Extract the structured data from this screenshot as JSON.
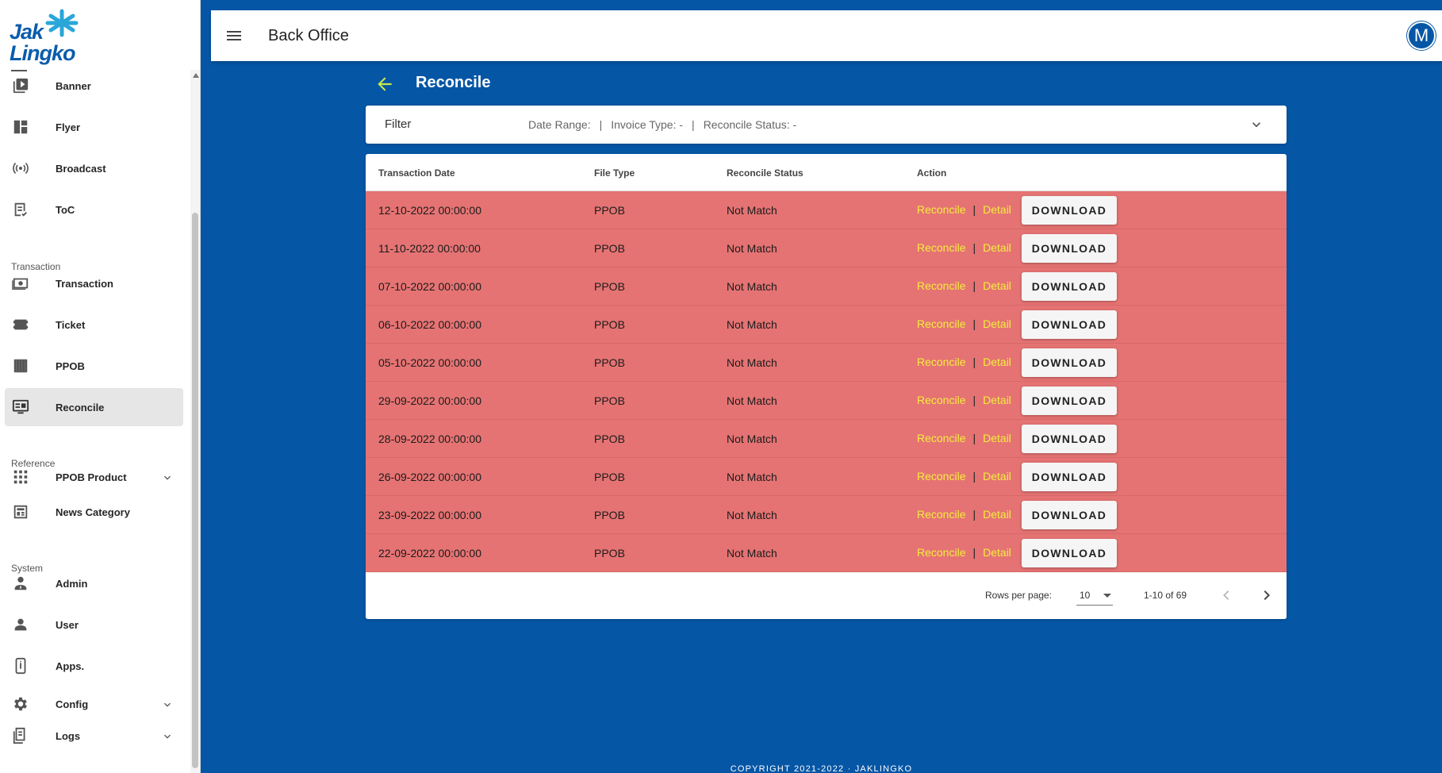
{
  "brand": {
    "line1": "Jak",
    "line2": "Lingko"
  },
  "appbar": {
    "title": "Back Office",
    "avatar_initial": "M"
  },
  "sidebar": {
    "items_top": [
      {
        "label": "Banner",
        "icon": "banner-icon"
      },
      {
        "label": "Flyer",
        "icon": "flyer-icon"
      },
      {
        "label": "Broadcast",
        "icon": "broadcast-icon"
      },
      {
        "label": "ToC",
        "icon": "toc-icon"
      }
    ],
    "section_transaction": "Transaction",
    "items_transaction": [
      {
        "label": "Transaction",
        "icon": "money-icon"
      },
      {
        "label": "Ticket",
        "icon": "ticket-icon"
      },
      {
        "label": "PPOB",
        "icon": "ppob-icon"
      },
      {
        "label": "Reconcile",
        "icon": "reconcile-icon",
        "active": true
      }
    ],
    "section_reference": "Reference",
    "items_reference": [
      {
        "label": "PPOB Product",
        "icon": "grid-icon",
        "expandable": true
      },
      {
        "label": "News Category",
        "icon": "news-icon"
      }
    ],
    "section_system": "System",
    "items_system": [
      {
        "label": "Admin",
        "icon": "admin-icon"
      },
      {
        "label": "User",
        "icon": "user-icon"
      },
      {
        "label": "Apps.",
        "icon": "apps-icon"
      },
      {
        "label": "Config",
        "icon": "gear-icon",
        "expandable": true
      },
      {
        "label": "Logs",
        "icon": "logs-icon",
        "expandable": true
      }
    ]
  },
  "page": {
    "title": "Reconcile"
  },
  "filter": {
    "title": "Filter",
    "date_range": "Date Range:",
    "invoice_type": "Invoice Type: -",
    "reconcile_status": "Reconcile Status: -",
    "separator": "|"
  },
  "table": {
    "headers": [
      "Transaction Date",
      "File Type",
      "Reconcile Status",
      "Action"
    ],
    "row_color": "#e57373",
    "action_reconcile": "Reconcile",
    "action_detail": "Detail",
    "action_sep": "|",
    "download_label": "DOWNLOAD",
    "rows": [
      {
        "date": "12-10-2022 00:00:00",
        "type": "PPOB",
        "status": "Not Match"
      },
      {
        "date": "11-10-2022 00:00:00",
        "type": "PPOB",
        "status": "Not Match"
      },
      {
        "date": "07-10-2022 00:00:00",
        "type": "PPOB",
        "status": "Not Match"
      },
      {
        "date": "06-10-2022 00:00:00",
        "type": "PPOB",
        "status": "Not Match"
      },
      {
        "date": "05-10-2022 00:00:00",
        "type": "PPOB",
        "status": "Not Match"
      },
      {
        "date": "29-09-2022 00:00:00",
        "type": "PPOB",
        "status": "Not Match"
      },
      {
        "date": "28-09-2022 00:00:00",
        "type": "PPOB",
        "status": "Not Match"
      },
      {
        "date": "26-09-2022 00:00:00",
        "type": "PPOB",
        "status": "Not Match"
      },
      {
        "date": "23-09-2022 00:00:00",
        "type": "PPOB",
        "status": "Not Match"
      },
      {
        "date": "22-09-2022 00:00:00",
        "type": "PPOB",
        "status": "Not Match"
      }
    ]
  },
  "pagination": {
    "rows_per_page_label": "Rows per page:",
    "rows_per_page": "10",
    "range": "1-10 of 69"
  },
  "footer": {
    "text": "COPYRIGHT 2021-2022 · JAKLINGKO"
  },
  "colors": {
    "primary": "#0556a5",
    "accent_arrow": "#c6e84a",
    "action_link": "#f2ee3b"
  }
}
